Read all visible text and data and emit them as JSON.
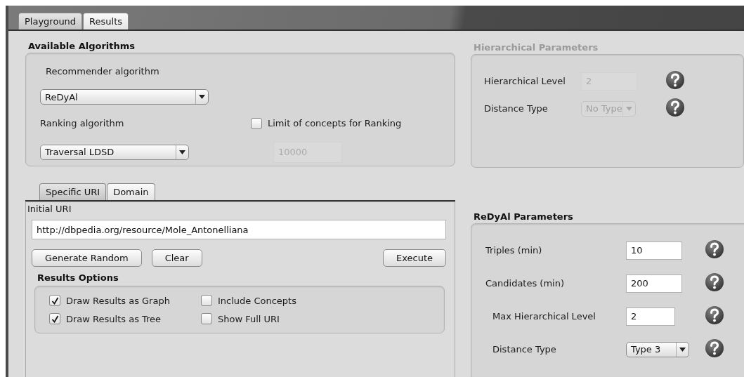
{
  "main_tabs": [
    {
      "label": "Playground",
      "selected": true
    },
    {
      "label": "Results",
      "selected": false
    }
  ],
  "algorithms": {
    "title": "Available Algorithms",
    "recommender_label": "Recommender algorithm",
    "recommender_value": "ReDyAl",
    "ranking_label": "Ranking algorithm",
    "ranking_value": "Traversal LDSD",
    "limit": {
      "label": "Limit of concepts for Ranking",
      "checked": false
    },
    "limit_field": {
      "value": "10000",
      "disabled": true
    }
  },
  "hierarchical": {
    "title": "Hierarchical Parameters",
    "disabled": true,
    "fields": [
      {
        "kind": "input",
        "label": "Hierarchical Level",
        "value": "2"
      },
      {
        "kind": "select",
        "label": "Distance Type",
        "value": "No Type"
      }
    ]
  },
  "uri_tabs": [
    {
      "label": "Specific URI",
      "selected": true
    },
    {
      "label": "Domain",
      "selected": false
    }
  ],
  "initial_uri": {
    "label": "Initial URI",
    "value": "http://dbpedia.org/resource/Mole_Antonelliana"
  },
  "buttons": [
    "Generate Random",
    "Clear",
    "Execute"
  ],
  "results_options": {
    "title": "Results Options",
    "options": [
      {
        "label": "Draw Results as Graph",
        "checked": true
      },
      {
        "label": "Include Concepts",
        "checked": false
      },
      {
        "label": "Draw Results as Tree",
        "checked": true
      },
      {
        "label": "Show Full URI",
        "checked": false
      }
    ]
  },
  "redyal": {
    "title": "ReDyAl Parameters",
    "disabled": false,
    "fields": [
      {
        "kind": "input",
        "label": "Triples (min)",
        "value": "10"
      },
      {
        "kind": "input",
        "label": "Candidates (min)",
        "value": "200"
      },
      {
        "kind": "input",
        "label": "Max Hierarchical Level",
        "value": "2"
      },
      {
        "kind": "select",
        "label": "Distance Type",
        "value": "Type 3"
      }
    ]
  }
}
